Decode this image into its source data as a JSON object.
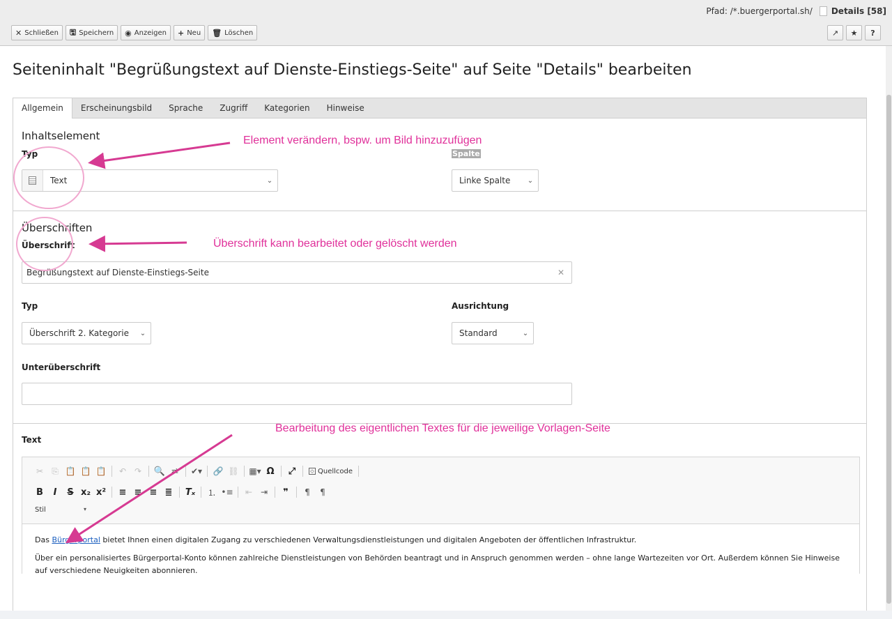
{
  "path": {
    "prefix": "Pfad: /*.buergerportal.sh/",
    "page": "Details [58]"
  },
  "toolbar": {
    "close": "Schließen",
    "save": "Speichern",
    "view": "Anzeigen",
    "new": "Neu",
    "delete": "Löschen",
    "right_icons": [
      "external-link-icon",
      "star-icon",
      "help-icon"
    ],
    "help": "?"
  },
  "title": "Seiteninhalt \"Begrüßungstext auf Dienste-Einstiegs-Seite\" auf Seite \"Details\" bearbeiten",
  "tabs": [
    "Allgemein",
    "Erscheinungsbild",
    "Sprache",
    "Zugriff",
    "Kategorien",
    "Hinweise"
  ],
  "sections": {
    "content_element": {
      "title": "Inhaltselement",
      "type_label": "Typ",
      "type_value": "Text",
      "column_label": "Spalte",
      "column_value": "Linke Spalte"
    },
    "headings": {
      "title": "Überschriften",
      "heading_label": "Überschrift",
      "heading_value": "Begrüßungstext auf Dienste-Einstiegs-Seite",
      "type_label": "Typ",
      "type_value": "Überschrift 2. Kategorie",
      "align_label": "Ausrichtung",
      "align_value": "Standard",
      "subheading_label": "Unterüberschrift",
      "subheading_value": ""
    },
    "text": {
      "label": "Text",
      "source_button": "Quellcode",
      "style_select": "Stil",
      "para1_before": "Das ",
      "para1_link": "Bürgerportal",
      "para1_after": " bietet Ihnen einen digitalen Zugang zu verschiedenen Verwaltungsdienstleistungen und digitalen Angeboten der öffentlichen Infrastruktur.",
      "para2": "Über ein personalisiertes Bürgerportal-Konto können zahlreiche Dienstleistungen von Behörden beantragt und in Anspruch genommen werden – ohne lange Wartezeiten vor Ort. Außerdem können Sie Hinweise auf verschiedene Neuigkeiten abonnieren."
    }
  },
  "annotations": {
    "a1": "Element verändern, bspw. um Bild hinzuzufügen",
    "a2": "Überschrift kann bearbeitet oder gelöscht werden",
    "a3": "Bearbeitung des eigentlichen Textes für die jeweilige Vorlagen-Seite"
  }
}
